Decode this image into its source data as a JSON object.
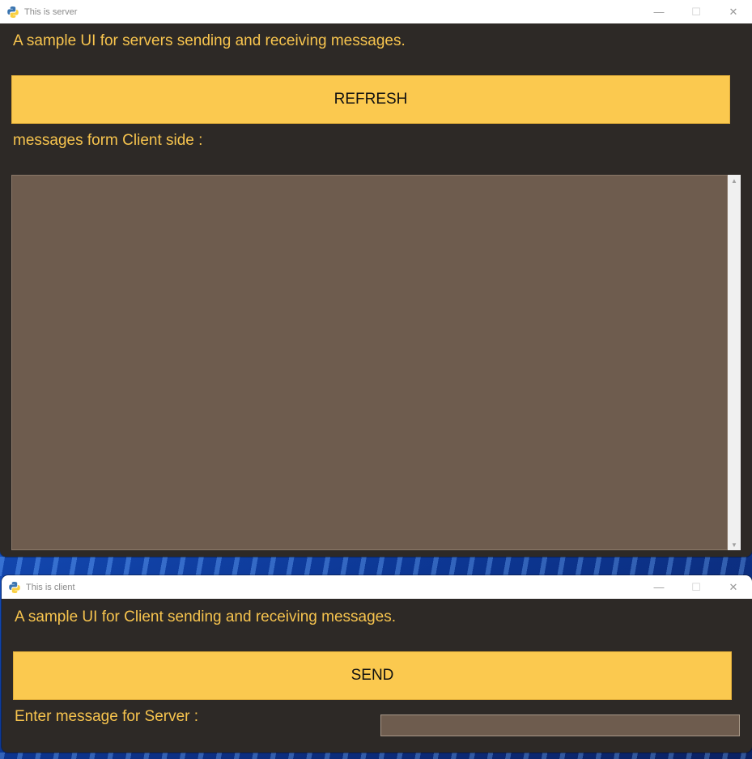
{
  "server_window": {
    "title": "This is server",
    "heading": "A sample UI for servers sending and receiving messages.",
    "refresh_label": "REFRESH",
    "messages_label": "messages form Client side :",
    "messages_text": ""
  },
  "client_window": {
    "title": "This is client",
    "heading": "A sample UI for Client sending and receiving messages.",
    "send_label": "SEND",
    "entry_label": "Enter message for Server :",
    "entry_value": ""
  },
  "window_controls": {
    "minimize": "—",
    "maximize": "☐",
    "close": "✕"
  },
  "colors": {
    "window_bg": "#2d2926",
    "accent_text": "#f7c44e",
    "button_bg": "#fbc94f",
    "field_bg": "#6e5c4e"
  },
  "icons": {
    "app": "python-icon",
    "minimize": "minimize-icon",
    "maximize": "maximize-icon",
    "close": "close-icon",
    "scroll_up": "scroll-up-arrow-icon",
    "scroll_down": "scroll-down-arrow-icon"
  }
}
